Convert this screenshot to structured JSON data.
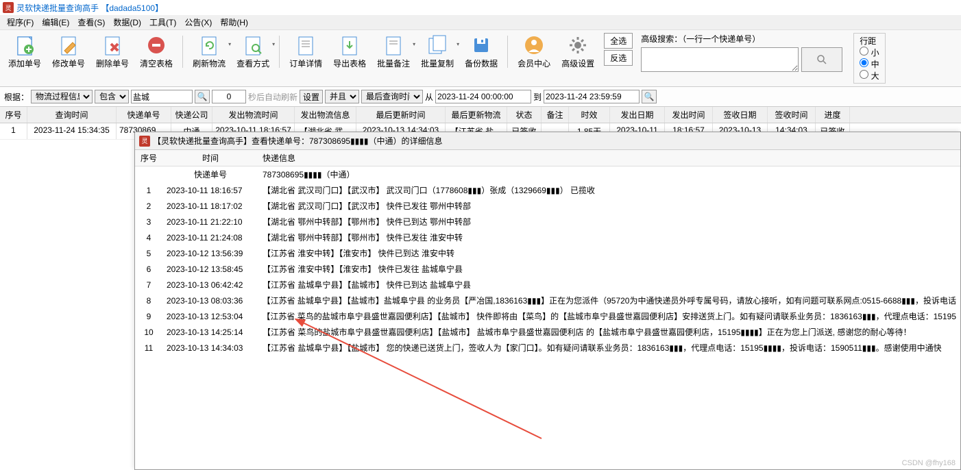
{
  "title": "灵软快递批量查询高手 【dadada5100】",
  "menu": [
    "程序(F)",
    "编辑(E)",
    "查看(S)",
    "数据(D)",
    "工具(T)",
    "公告(X)",
    "帮助(H)"
  ],
  "toolbar": [
    {
      "label": "添加单号",
      "icon": "add"
    },
    {
      "label": "修改单号",
      "icon": "edit"
    },
    {
      "label": "删除单号",
      "icon": "del"
    },
    {
      "label": "清空表格",
      "icon": "clear"
    },
    {
      "label": "刷新物流",
      "icon": "refresh",
      "dd": true
    },
    {
      "label": "查看方式",
      "icon": "view",
      "dd": true
    },
    {
      "label": "订单详情",
      "icon": "detail"
    },
    {
      "label": "导出表格",
      "icon": "export"
    },
    {
      "label": "批量备注",
      "icon": "note",
      "dd": true
    },
    {
      "label": "批量复制",
      "icon": "copy",
      "dd": true
    },
    {
      "label": "备份数据",
      "icon": "backup"
    },
    {
      "label": "会员中心",
      "icon": "member"
    },
    {
      "label": "高级设置",
      "icon": "settings"
    }
  ],
  "sideButtons": {
    "all": "全选",
    "inv": "反选"
  },
  "search": {
    "label": "高级搜索：（一行一个快递单号）",
    "placeholder": ""
  },
  "lineSpacing": {
    "title": "行距",
    "options": [
      "小",
      "中",
      "大"
    ],
    "selected": "中"
  },
  "filter": {
    "root": "根据：",
    "field": "物流过程信息",
    "op": "包含",
    "value": "盐城",
    "count": "0",
    "autoRefresh": "秒后自动刷新",
    "set": "设置",
    "and": "并且",
    "lastTime": "最后查询时间",
    "from": "从",
    "fromVal": "2023-11-24 00:00:00",
    "to": "到",
    "toVal": "2023-11-24 23:59:59"
  },
  "gridCols": [
    "序号",
    "查询时间",
    "快递单号",
    "快递公司",
    "发出物流时间",
    "发出物流信息",
    "最后更新时间",
    "最后更新物流",
    "状态",
    "备注",
    "时效",
    "发出日期",
    "发出时间",
    "签收日期",
    "签收时间",
    "进度"
  ],
  "gridWidths": [
    40,
    130,
    80,
    60,
    120,
    90,
    130,
    90,
    50,
    40,
    60,
    80,
    70,
    80,
    70,
    50
  ],
  "gridRow": [
    "1",
    "2023-11-24 15:34:35",
    "787308695…",
    "中通",
    "2023-10-11 18:16:57",
    "【湖北省 武…",
    "2023-10-13 14:34:03",
    "【江苏省 盐…",
    "已签收",
    "",
    "1.85天",
    "2023-10-11",
    "18:16:57",
    "2023-10-13",
    "14:34:03",
    "已签收"
  ],
  "detail": {
    "title": "【灵软快递批量查询高手】查看快递单号：787308695▮▮▮▮（中通）的详细信息",
    "header": [
      "序号",
      "时间",
      "快递信息"
    ],
    "sub": {
      "label": "快递单号",
      "val": "787308695▮▮▮▮（中通）"
    },
    "rows": [
      {
        "n": "1",
        "t": "2023-10-11 18:16:57",
        "m": "【湖北省 武汉司门口】【武汉市】 武汉司门口（1778608▮▮▮）张成（1329669▮▮▮）  已揽收"
      },
      {
        "n": "2",
        "t": "2023-10-11 18:17:02",
        "m": "【湖北省 武汉司门口】【武汉市】 快件已发往 鄂州中转部"
      },
      {
        "n": "3",
        "t": "2023-10-11 21:22:10",
        "m": "【湖北省 鄂州中转部】【鄂州市】 快件已到达 鄂州中转部"
      },
      {
        "n": "4",
        "t": "2023-10-11 21:24:08",
        "m": "【湖北省 鄂州中转部】【鄂州市】 快件已发往 淮安中转"
      },
      {
        "n": "5",
        "t": "2023-10-12 13:56:39",
        "m": "【江苏省 淮安中转】【淮安市】 快件已到达 淮安中转"
      },
      {
        "n": "6",
        "t": "2023-10-12 13:58:45",
        "m": "【江苏省 淮安中转】【淮安市】 快件已发往 盐城阜宁县"
      },
      {
        "n": "7",
        "t": "2023-10-13 06:42:42",
        "m": "【江苏省 盐城阜宁县】【盐城市】 快件已到达 盐城阜宁县"
      },
      {
        "n": "8",
        "t": "2023-10-13 08:03:36",
        "m": "【江苏省 盐城阜宁县】【盐城市】盐城阜宁县 的业务员【严冶国,1836163▮▮▮】正在为您派件（95720为中通快递员外呼专属号码，请放心接听，如有问题可联系网点:0515-6688▮▮▮，投诉电话"
      },
      {
        "n": "9",
        "t": "2023-10-13 12:53:04",
        "m": "【江苏省 菜鸟的盐城市阜宁县盛世嘉园便利店】【盐城市】 快件即将由【菜鸟】的【盐城市阜宁县盛世嘉园便利店】安排送货上门。如有疑问请联系业务员：1836163▮▮▮，代理点电话：15195"
      },
      {
        "n": "10",
        "t": "2023-10-13 14:25:14",
        "m": "【江苏省 菜鸟的盐城市阜宁县盛世嘉园便利店】【盐城市】 盐城市阜宁县盛世嘉园便利店 的【盐城市阜宁县盛世嘉园便利店，15195▮▮▮▮】正在为您上门派送, 感谢您的耐心等待！"
      },
      {
        "n": "11",
        "t": "2023-10-13 14:34:03",
        "m": "【江苏省 盐城阜宁县】【盐城市】 您的快递已送货上门，签收人为【家门口】。如有疑问请联系业务员：1836163▮▮▮，代理点电话：15195▮▮▮▮，投诉电话：1590511▮▮▮。感谢使用中通快"
      }
    ]
  },
  "watermark": "CSDN @fhy168"
}
